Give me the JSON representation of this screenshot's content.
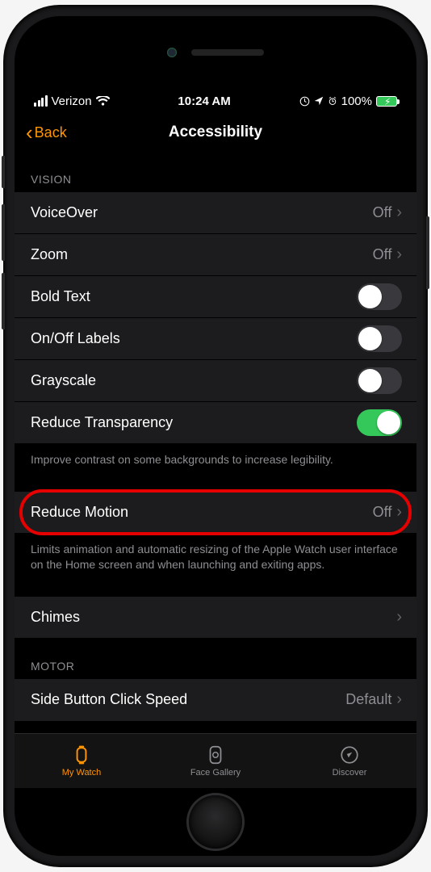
{
  "status": {
    "carrier": "Verizon",
    "time": "10:24 AM",
    "battery_pct": "100%"
  },
  "nav": {
    "back_label": "Back",
    "title": "Accessibility"
  },
  "sections": [
    {
      "header": "VISION"
    }
  ],
  "rows": {
    "voiceover": {
      "label": "VoiceOver",
      "value": "Off"
    },
    "zoom": {
      "label": "Zoom",
      "value": "Off"
    },
    "bold_text": {
      "label": "Bold Text",
      "on": false
    },
    "onoff_labels": {
      "label": "On/Off Labels",
      "on": false
    },
    "grayscale": {
      "label": "Grayscale",
      "on": false
    },
    "reduce_transparency": {
      "label": "Reduce Transparency",
      "on": true
    },
    "reduce_transparency_footer": "Improve contrast on some backgrounds to increase legibility.",
    "reduce_motion": {
      "label": "Reduce Motion",
      "value": "Off"
    },
    "reduce_motion_footer": "Limits animation and automatic resizing of the Apple Watch user interface on the Home screen and when launching and exiting apps.",
    "chimes": {
      "label": "Chimes"
    }
  },
  "motor_header": "MOTOR",
  "side_button": {
    "label": "Side Button Click Speed",
    "value": "Default"
  },
  "tabs": {
    "my_watch": "My Watch",
    "face_gallery": "Face Gallery",
    "discover": "Discover"
  }
}
